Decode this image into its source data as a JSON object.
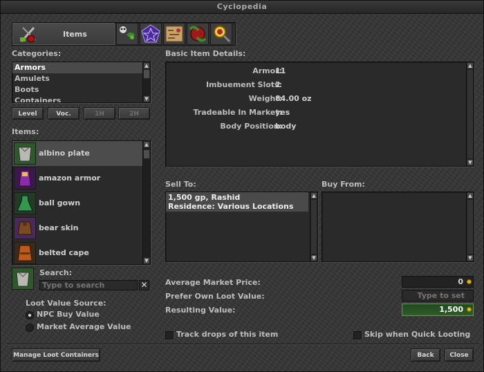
{
  "window": {
    "title": "Cyclopedia"
  },
  "tabs": [
    {
      "label": "Items",
      "icon": "items-tab-icon"
    },
    {
      "icon": "bestiary-tab-icon"
    },
    {
      "icon": "charms-tab-icon"
    },
    {
      "icon": "map-tab-icon"
    },
    {
      "icon": "houses-tab-icon"
    },
    {
      "icon": "character-tab-icon"
    }
  ],
  "categories": {
    "label": "Categories:",
    "items": [
      "Armors",
      "Amulets",
      "Boots",
      "Containers"
    ],
    "selected": "Armors"
  },
  "filters": {
    "level": "Level",
    "voc": "Voc.",
    "one_hand": "1H",
    "two_hand": "2H"
  },
  "items": {
    "label": "Items:",
    "list": [
      {
        "name": "albino plate",
        "icon": "albino-plate-icon",
        "selected": true
      },
      {
        "name": "amazon armor",
        "icon": "amazon-armor-icon"
      },
      {
        "name": "ball gown",
        "icon": "ball-gown-icon"
      },
      {
        "name": "bear skin",
        "icon": "bear-skin-icon"
      },
      {
        "name": "belted cape",
        "icon": "belted-cape-icon"
      }
    ]
  },
  "search": {
    "label": "Search:",
    "placeholder": "Type to search"
  },
  "loot_source": {
    "label": "Loot Value Source:",
    "options": [
      "NPC Buy Value",
      "Market Average Value"
    ],
    "selected": "NPC Buy Value"
  },
  "details": {
    "label": "Basic Item Details:",
    "rows": [
      {
        "key": "Armor:",
        "value": "11"
      },
      {
        "key": "Imbuement Slots:",
        "value": "2"
      },
      {
        "key": "Weight:",
        "value": "84.00 oz"
      },
      {
        "key": "Tradeable In Market:",
        "value": "yes"
      },
      {
        "key": "Body Position:",
        "value": "body"
      }
    ]
  },
  "sell_to": {
    "label": "Sell To:",
    "line1": "1,500 gp, Rashid",
    "line2": "Residence: Various Locations"
  },
  "buy_from": {
    "label": "Buy From:"
  },
  "prices": {
    "average_label": "Average Market Price:",
    "average_value": "0",
    "own_label": "Prefer Own Loot Value:",
    "own_placeholder": "Type to set",
    "result_label": "Resulting Value:",
    "result_value": "1,500"
  },
  "options": {
    "track_drops": "Track drops of this item",
    "skip_quick_loot": "Skip when Quick Looting"
  },
  "footer": {
    "manage": "Manage Loot Containers",
    "back": "Back",
    "close": "Close"
  },
  "colors": {
    "coin": "#e6b800",
    "result_bg": "#2f5a2a"
  }
}
